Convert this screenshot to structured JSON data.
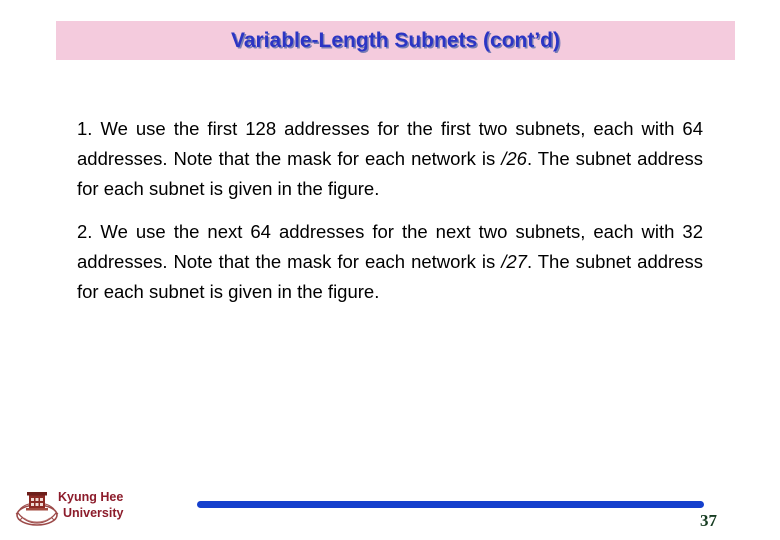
{
  "slide": {
    "title": "Variable-Length Subnets (cont’d)",
    "title_color": "#2b35c4",
    "title_band_color": "#f4cbdd",
    "background_color": "#ffffff",
    "body": [
      {
        "id": "item-1",
        "number": "1.",
        "text_before_mask": "1. We use the first 128 addresses for the first two subnets, each with 64 addresses. Note that the mask for each network is ",
        "mask": "/26",
        "text_after_mask": ". The subnet address for each subnet is given in the figure."
      },
      {
        "id": "item-2",
        "number": "2.",
        "text_before_mask": "2. We use the next 64 addresses for the next two subnets, each with 32 addresses. Note that the mask for each network is ",
        "mask": "/27",
        "text_after_mask": ". The subnet address for each subnet is given in the figure."
      }
    ],
    "footer": {
      "university_line1": "Kyung Hee",
      "university_line2": "University",
      "university_color": "#8c1c2b",
      "logo_icon": "kyung-hee-crest-icon",
      "rule_color": "#1540cd",
      "page_number": "37",
      "page_number_color": "#173d22"
    }
  }
}
